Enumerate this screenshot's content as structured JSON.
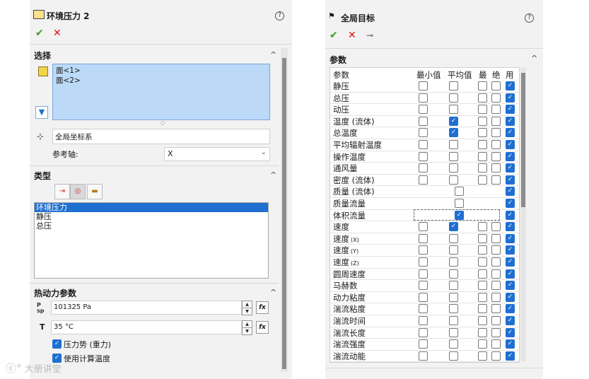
{
  "left": {
    "title": "环境压力 2",
    "help": "?",
    "selection": {
      "header": "选择",
      "faces": [
        "面<1>",
        "面<2>"
      ],
      "coord_system": "全局坐标系",
      "ref_axis_label": "参考轴:",
      "ref_axis_value": "X"
    },
    "type": {
      "header": "类型",
      "items": [
        "环境压力",
        "静压",
        "总压"
      ],
      "selected_index": 0
    },
    "thermo": {
      "header": "热动力参数",
      "pressure_value": "101325 Pa",
      "pressure_icon_text": "P\nsp",
      "temp_label": "T",
      "temp_value": "35 °C",
      "fx_label": "fx",
      "options": [
        {
          "label": "压力势 (重力)",
          "checked": true
        },
        {
          "label": "使用计算温度",
          "checked": true
        }
      ]
    }
  },
  "right": {
    "title": "全局目标",
    "help": "?",
    "params_header": "参数",
    "columns": [
      "参数",
      "最小值",
      "平均值",
      "最",
      "绝",
      "用"
    ],
    "rows": [
      {
        "name": "静压",
        "min": false,
        "avg": false,
        "max": false,
        "bulk": false,
        "use": true
      },
      {
        "name": "总压",
        "min": false,
        "avg": false,
        "max": false,
        "bulk": false,
        "use": true
      },
      {
        "name": "动压",
        "min": false,
        "avg": false,
        "max": false,
        "bulk": false,
        "use": true
      },
      {
        "name": "温度 (流体)",
        "min": false,
        "avg": true,
        "max": false,
        "bulk": false,
        "use": true
      },
      {
        "name": "总温度",
        "min": false,
        "avg": true,
        "max": false,
        "bulk": false,
        "use": true
      },
      {
        "name": "平均辐射温度",
        "min": false,
        "avg": false,
        "max": false,
        "bulk": false,
        "use": true
      },
      {
        "name": "操作温度",
        "min": false,
        "avg": false,
        "max": false,
        "bulk": false,
        "use": true
      },
      {
        "name": "通风量",
        "min": false,
        "avg": false,
        "max": false,
        "bulk": false,
        "use": true
      },
      {
        "name": "密度 (流体)",
        "min": false,
        "avg": false,
        "max": false,
        "bulk": false,
        "use": true
      },
      {
        "name": "质量 (流体)",
        "single": true,
        "value": false,
        "use": true
      },
      {
        "name": "质量流量",
        "single": true,
        "value": false,
        "use": true
      },
      {
        "name": "体积流量",
        "single": true,
        "value": true,
        "use": true,
        "focused": true
      },
      {
        "name": "速度",
        "min": false,
        "avg": true,
        "max": false,
        "bulk": false,
        "use": true
      },
      {
        "name": "速度",
        "suffix": "(X)",
        "min": false,
        "avg": false,
        "max": false,
        "bulk": false,
        "use": true
      },
      {
        "name": "速度",
        "suffix": "(Y)",
        "min": false,
        "avg": false,
        "max": false,
        "bulk": false,
        "use": true
      },
      {
        "name": "速度",
        "suffix": "(Z)",
        "min": false,
        "avg": false,
        "max": false,
        "bulk": false,
        "use": true
      },
      {
        "name": "圆周速度",
        "min": false,
        "avg": false,
        "max": false,
        "bulk": false,
        "use": true
      },
      {
        "name": "马赫数",
        "min": false,
        "avg": false,
        "max": false,
        "bulk": false,
        "use": true
      },
      {
        "name": "动力粘度",
        "min": false,
        "avg": false,
        "max": false,
        "bulk": false,
        "use": true
      },
      {
        "name": "湍流粘度",
        "min": false,
        "avg": false,
        "max": false,
        "bulk": false,
        "use": true
      },
      {
        "name": "湍流时间",
        "min": false,
        "avg": false,
        "max": false,
        "bulk": false,
        "use": true
      },
      {
        "name": "湍流长度",
        "min": false,
        "avg": false,
        "max": false,
        "bulk": false,
        "use": true
      },
      {
        "name": "湍流强度",
        "min": false,
        "avg": false,
        "max": false,
        "bulk": false,
        "use": true
      },
      {
        "name": "湍流动能",
        "min": false,
        "avg": false,
        "max": false,
        "bulk": false,
        "use": true
      }
    ]
  },
  "watermark": "大册讲堂",
  "colors": {
    "accent": "#1f6fd1",
    "selection": "#bcd9f7",
    "ok": "#3a9a1e",
    "cancel": "#dd1111"
  }
}
